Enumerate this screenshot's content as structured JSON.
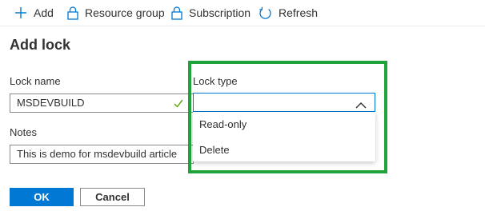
{
  "toolbar": {
    "add": {
      "label": "Add",
      "icon": "plus-icon"
    },
    "resource_group": {
      "label": "Resource group",
      "icon": "lock-icon"
    },
    "subscription": {
      "label": "Subscription",
      "icon": "lock-icon"
    },
    "refresh": {
      "label": "Refresh",
      "icon": "refresh-icon"
    }
  },
  "panel": {
    "title": "Add lock"
  },
  "form": {
    "lock_name": {
      "label": "Lock name",
      "value": "MSDEVBUILD",
      "valid": true
    },
    "lock_type": {
      "label": "Lock type",
      "value": "",
      "options": [
        "Read-only",
        "Delete"
      ],
      "expanded": true
    },
    "notes": {
      "label": "Notes",
      "value": "This is demo for msdevbuild article"
    }
  },
  "buttons": {
    "ok": "OK",
    "cancel": "Cancel"
  },
  "colors": {
    "accent": "#0078d4",
    "highlight": "#20a33b",
    "valid_check": "#57a300"
  }
}
